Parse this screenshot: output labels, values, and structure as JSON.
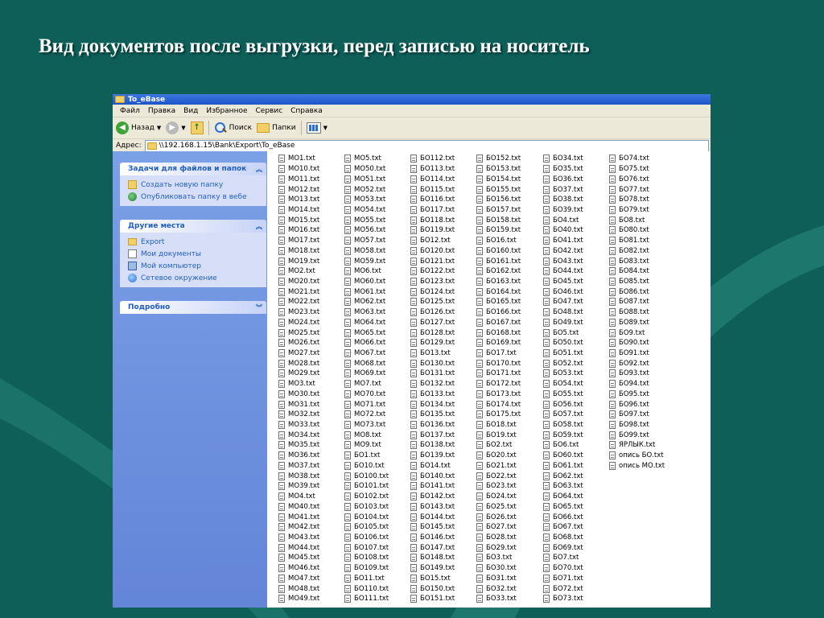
{
  "slide": {
    "title": "Вид документов после выгрузки, перед записью на носитель"
  },
  "window": {
    "title": "To_eBase",
    "menu": [
      "Файл",
      "Правка",
      "Вид",
      "Избранное",
      "Сервис",
      "Справка"
    ],
    "toolbar": {
      "back_label": "Назад",
      "search_label": "Поиск",
      "folders_label": "Папки"
    },
    "address": {
      "label": "Адрес:",
      "value": "\\\\192.168.1.15\\Bank\\Export\\To_eBase"
    }
  },
  "taskpane": {
    "file_tasks": {
      "title": "Задачи для файлов и папок",
      "items": [
        "Создать новую папку",
        "Опубликовать папку в вебе"
      ]
    },
    "other_places": {
      "title": "Другие места",
      "items": [
        "Export",
        "Мои документы",
        "Мой компьютер",
        "Сетевое окружение"
      ]
    },
    "details": {
      "title": "Подробно"
    }
  },
  "files": [
    [
      "МО1.txt",
      "МО10.txt",
      "МО11.txt",
      "МО12.txt",
      "МО13.txt",
      "МО14.txt",
      "МО15.txt",
      "МО16.txt",
      "МО17.txt",
      "МО18.txt",
      "МО19.txt",
      "МО2.txt",
      "МО20.txt",
      "МО21.txt",
      "МО22.txt",
      "МО23.txt",
      "МО24.txt",
      "МО25.txt",
      "МО26.txt",
      "МО27.txt",
      "МО28.txt",
      "МО29.txt",
      "МО3.txt",
      "МО30.txt",
      "МО31.txt",
      "МО32.txt",
      "МО33.txt",
      "МО34.txt",
      "МО35.txt",
      "МО36.txt",
      "МО37.txt",
      "МО38.txt",
      "МО39.txt",
      "МО4.txt",
      "МО40.txt",
      "МО41.txt",
      "МО42.txt",
      "МО43.txt",
      "МО44.txt",
      "МО45.txt",
      "МО46.txt",
      "МО47.txt",
      "МО48.txt",
      "МО49.txt"
    ],
    [
      "МО5.txt",
      "МО50.txt",
      "МО51.txt",
      "МО52.txt",
      "МО53.txt",
      "МО54.txt",
      "МО55.txt",
      "МО56.txt",
      "МО57.txt",
      "МО58.txt",
      "МО59.txt",
      "МО6.txt",
      "МО60.txt",
      "МО61.txt",
      "МО62.txt",
      "МО63.txt",
      "МО64.txt",
      "МО65.txt",
      "МО66.txt",
      "МО67.txt",
      "МО68.txt",
      "МО69.txt",
      "МО7.txt",
      "МО70.txt",
      "МО71.txt",
      "МО72.txt",
      "МО73.txt",
      "МО8.txt",
      "МО9.txt",
      "БО1.txt",
      "БО10.txt",
      "БО100.txt",
      "БО101.txt",
      "БО102.txt",
      "БО103.txt",
      "БО104.txt",
      "БО105.txt",
      "БО106.txt",
      "БО107.txt",
      "БО108.txt",
      "БО109.txt",
      "БО11.txt",
      "БО110.txt",
      "БО111.txt"
    ],
    [
      "БО112.txt",
      "БО113.txt",
      "БО114.txt",
      "БО115.txt",
      "БО116.txt",
      "БО117.txt",
      "БО118.txt",
      "БО119.txt",
      "БО12.txt",
      "БО120.txt",
      "БО121.txt",
      "БО122.txt",
      "БО123.txt",
      "БО124.txt",
      "БО125.txt",
      "БО126.txt",
      "БО127.txt",
      "БО128.txt",
      "БО129.txt",
      "БО13.txt",
      "БО130.txt",
      "БО131.txt",
      "БО132.txt",
      "БО133.txt",
      "БО134.txt",
      "БО135.txt",
      "БО136.txt",
      "БО137.txt",
      "БО138.txt",
      "БО139.txt",
      "БО14.txt",
      "БО140.txt",
      "БО141.txt",
      "БО142.txt",
      "БО143.txt",
      "БО144.txt",
      "БО145.txt",
      "БО146.txt",
      "БО147.txt",
      "БО148.txt",
      "БО149.txt",
      "БО15.txt",
      "БО150.txt",
      "БО151.txt"
    ],
    [
      "БО152.txt",
      "БО153.txt",
      "БО154.txt",
      "БО155.txt",
      "БО156.txt",
      "БО157.txt",
      "БО158.txt",
      "БО159.txt",
      "БО16.txt",
      "БО160.txt",
      "БО161.txt",
      "БО162.txt",
      "БО163.txt",
      "БО164.txt",
      "БО165.txt",
      "БО166.txt",
      "БО167.txt",
      "БО168.txt",
      "БО169.txt",
      "БО17.txt",
      "БО170.txt",
      "БО171.txt",
      "БО172.txt",
      "БО173.txt",
      "БО174.txt",
      "БО175.txt",
      "БО18.txt",
      "БО19.txt",
      "БО2.txt",
      "БО20.txt",
      "БО21.txt",
      "БО22.txt",
      "БО23.txt",
      "БО24.txt",
      "БО25.txt",
      "БО26.txt",
      "БО27.txt",
      "БО28.txt",
      "БО29.txt",
      "БО3.txt",
      "БО30.txt",
      "БО31.txt",
      "БО32.txt",
      "БО33.txt"
    ],
    [
      "БО34.txt",
      "БО35.txt",
      "БО36.txt",
      "БО37.txt",
      "БО38.txt",
      "БО39.txt",
      "БО4.txt",
      "БО40.txt",
      "БО41.txt",
      "БО42.txt",
      "БО43.txt",
      "БО44.txt",
      "БО45.txt",
      "БО46.txt",
      "БО47.txt",
      "БО48.txt",
      "БО49.txt",
      "БО5.txt",
      "БО50.txt",
      "БО51.txt",
      "БО52.txt",
      "БО53.txt",
      "БО54.txt",
      "БО55.txt",
      "БО56.txt",
      "БО57.txt",
      "БО58.txt",
      "БО59.txt",
      "БО6.txt",
      "БО60.txt",
      "БО61.txt",
      "БО62.txt",
      "БО63.txt",
      "БО64.txt",
      "БО65.txt",
      "БО66.txt",
      "БО67.txt",
      "БО68.txt",
      "БО69.txt",
      "БО7.txt",
      "БО70.txt",
      "БО71.txt",
      "БО72.txt",
      "БО73.txt"
    ],
    [
      "БО74.txt",
      "БО75.txt",
      "БО76.txt",
      "БО77.txt",
      "БО78.txt",
      "БО79.txt",
      "БО8.txt",
      "БО80.txt",
      "БО81.txt",
      "БО82.txt",
      "БО83.txt",
      "БО84.txt",
      "БО85.txt",
      "БО86.txt",
      "БО87.txt",
      "БО88.txt",
      "БО89.txt",
      "БО9.txt",
      "БО90.txt",
      "БО91.txt",
      "БО92.txt",
      "БО93.txt",
      "БО94.txt",
      "БО95.txt",
      "БО96.txt",
      "БО97.txt",
      "БО98.txt",
      "БО99.txt",
      "ЯРЛЫК.txt",
      "опись БО.txt",
      "опись МО.txt"
    ]
  ]
}
